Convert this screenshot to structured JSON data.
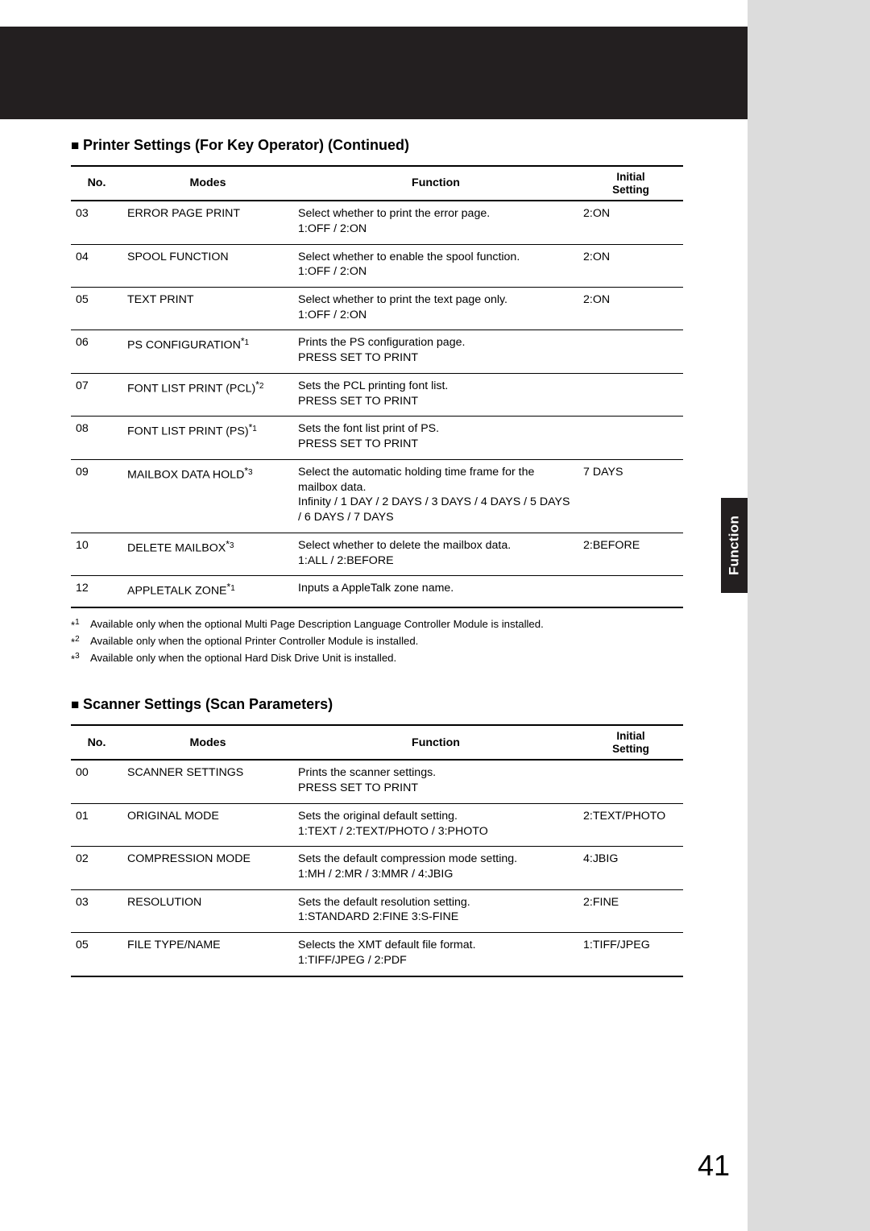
{
  "side_tab": "Function",
  "page_number": "41",
  "section1": {
    "title": "Printer Settings  (For Key Operator) (Continued)",
    "headers": {
      "no": "No.",
      "modes": "Modes",
      "function": "Function",
      "initial": "Initial\nSetting"
    },
    "rows": [
      {
        "no": "03",
        "mode": "ERROR PAGE PRINT",
        "sup": "",
        "func_l1": "Select whether to print the error page.",
        "func_l2": "1:OFF / 2:ON",
        "init": "2:ON"
      },
      {
        "no": "04",
        "mode": "SPOOL FUNCTION",
        "sup": "",
        "func_l1": "Select whether to enable the spool function.",
        "func_l2": "1:OFF / 2:ON",
        "init": "2:ON"
      },
      {
        "no": "05",
        "mode": "TEXT PRINT",
        "sup": "",
        "func_l1": "Select whether to print the text page only.",
        "func_l2": "1:OFF / 2:ON",
        "init": "2:ON"
      },
      {
        "no": "06",
        "mode": "PS CONFIGURATION",
        "sup": "1",
        "func_l1": "Prints the PS configuration page.",
        "func_l2": "PRESS SET TO PRINT",
        "init": ""
      },
      {
        "no": "07",
        "mode": "FONT LIST PRINT (PCL)",
        "sup": "2",
        "func_l1": "Sets the PCL printing font list.",
        "func_l2": "PRESS SET TO PRINT",
        "init": ""
      },
      {
        "no": "08",
        "mode": "FONT LIST PRINT (PS)",
        "sup": "1",
        "func_l1": "Sets the font list print of PS.",
        "func_l2": "PRESS SET TO PRINT",
        "init": ""
      },
      {
        "no": "09",
        "mode": "MAILBOX DATA HOLD",
        "sup": "3",
        "func_l1": "Select the automatic holding time frame for the mailbox data.",
        "func_l2": "Infinity / 1 DAY / 2 DAYS / 3 DAYS / 4 DAYS / 5 DAYS / 6 DAYS / 7 DAYS",
        "init": "7 DAYS"
      },
      {
        "no": "10",
        "mode": "DELETE MAILBOX",
        "sup": "3",
        "func_l1": "Select whether to delete the mailbox data.",
        "func_l2": "1:ALL / 2:BEFORE",
        "init": "2:BEFORE"
      },
      {
        "no": "12",
        "mode": "APPLETALK ZONE",
        "sup": "1",
        "func_l1": "Inputs a AppleTalk zone name.",
        "func_l2": "",
        "init": ""
      }
    ],
    "footnotes": [
      {
        "mark": "1",
        "text": "Available only when the optional Multi Page Description Language Controller Module is installed."
      },
      {
        "mark": "2",
        "text": "Available only when the optional Printer Controller Module is installed."
      },
      {
        "mark": "3",
        "text": "Available only when the optional Hard Disk Drive Unit is installed."
      }
    ]
  },
  "section2": {
    "title": "Scanner Settings (Scan Parameters)",
    "headers": {
      "no": "No.",
      "modes": "Modes",
      "function": "Function",
      "initial": "Initial\nSetting"
    },
    "rows": [
      {
        "no": "00",
        "mode": "SCANNER SETTINGS",
        "sup": "",
        "func_l1": "Prints the scanner settings.",
        "func_l2": "PRESS SET TO PRINT",
        "init": ""
      },
      {
        "no": "01",
        "mode": "ORIGINAL MODE",
        "sup": "",
        "func_l1": "Sets the original default setting.",
        "func_l2": "1:TEXT / 2:TEXT/PHOTO / 3:PHOTO",
        "init": "2:TEXT/PHOTO"
      },
      {
        "no": "02",
        "mode": "COMPRESSION MODE",
        "sup": "",
        "func_l1": "Sets the default compression mode setting.",
        "func_l2": "1:MH / 2:MR / 3:MMR / 4:JBIG",
        "init": "4:JBIG"
      },
      {
        "no": "03",
        "mode": "RESOLUTION",
        "sup": "",
        "func_l1": "Sets the default resolution setting.",
        "func_l2": "1:STANDARD 2:FINE 3:S-FINE",
        "init": "2:FINE"
      },
      {
        "no": "05",
        "mode": "FILE TYPE/NAME",
        "sup": "",
        "func_l1": "Selects the XMT default file format.",
        "func_l2": "1:TIFF/JPEG / 2:PDF",
        "init": "1:TIFF/JPEG"
      }
    ]
  }
}
